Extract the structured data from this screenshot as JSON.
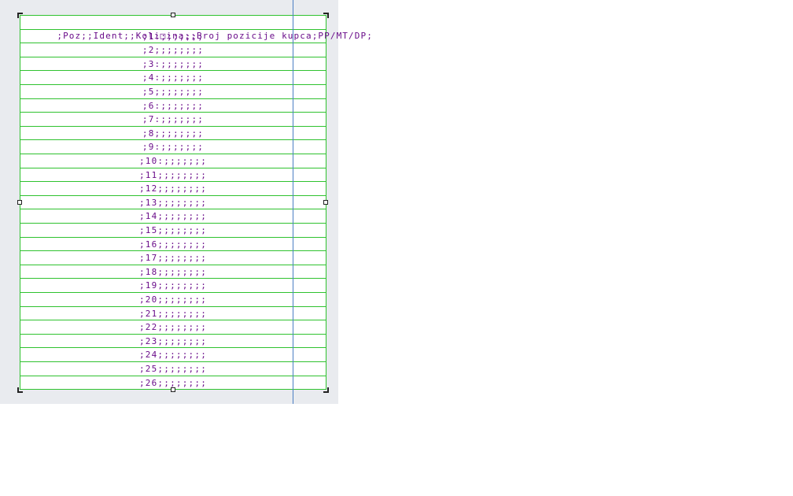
{
  "table": {
    "header": ";Poz;;Ident;;Koli□ina;;Broj pozicije kupca;PP/MT/DP;",
    "rows": [
      ";1:;;;;;;;",
      ";2;;;;;;;;",
      ";3:;;;;;;;",
      ";4:;;;;;;;",
      ";5;;;;;;;;",
      ";6:;;;;;;;",
      ";7:;;;;;;;",
      ";8;;;;;;;;",
      ";9:;;;;;;;",
      ";10:;;;;;;;",
      ";11;;;;;;;;",
      ";12;;;;;;;;",
      ";13;;;;;;;;",
      ";14;;;;;;;;",
      ";15;;;;;;;;",
      ";16;;;;;;;;",
      ";17;;;;;;;;",
      ";18;;;;;;;;",
      ";19;;;;;;;;",
      ";20;;;;;;;;",
      ";21;;;;;;;;",
      ";22;;;;;;;;",
      ";23;;;;;;;;",
      ";24;;;;;;;;",
      ";25;;;;;;;;",
      ";26;;;;;;;;"
    ]
  },
  "colors": {
    "grid_line": "#2fc22f",
    "text": "#6a0d8a",
    "margin_guide": "#4c7fc4",
    "canvas_background": "#e9ebef"
  }
}
